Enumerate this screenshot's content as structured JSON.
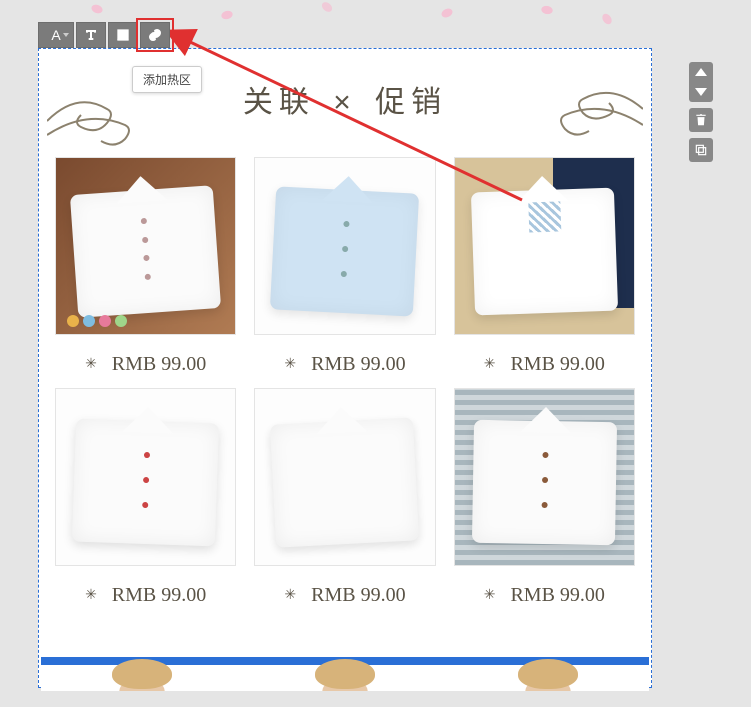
{
  "toolbar": {
    "text_tool_label": "A",
    "tooltip_add_hotspot": "添加热区"
  },
  "section": {
    "title_left": "关联",
    "title_sep": "×",
    "title_right": "促销"
  },
  "products": [
    {
      "currency": "RMB",
      "price": "99.00",
      "variant": "white-pocket-cat"
    },
    {
      "currency": "RMB",
      "price": "99.00",
      "variant": "lightblue-embroider"
    },
    {
      "currency": "RMB",
      "price": "99.00",
      "variant": "white-blue-pattern"
    },
    {
      "currency": "RMB",
      "price": "99.00",
      "variant": "white-red-tag"
    },
    {
      "currency": "RMB",
      "price": "99.00",
      "variant": "white-gauze"
    },
    {
      "currency": "RMB",
      "price": "99.00",
      "variant": "white-brown-buttons"
    }
  ],
  "arrow": {
    "color": "#e03030"
  }
}
